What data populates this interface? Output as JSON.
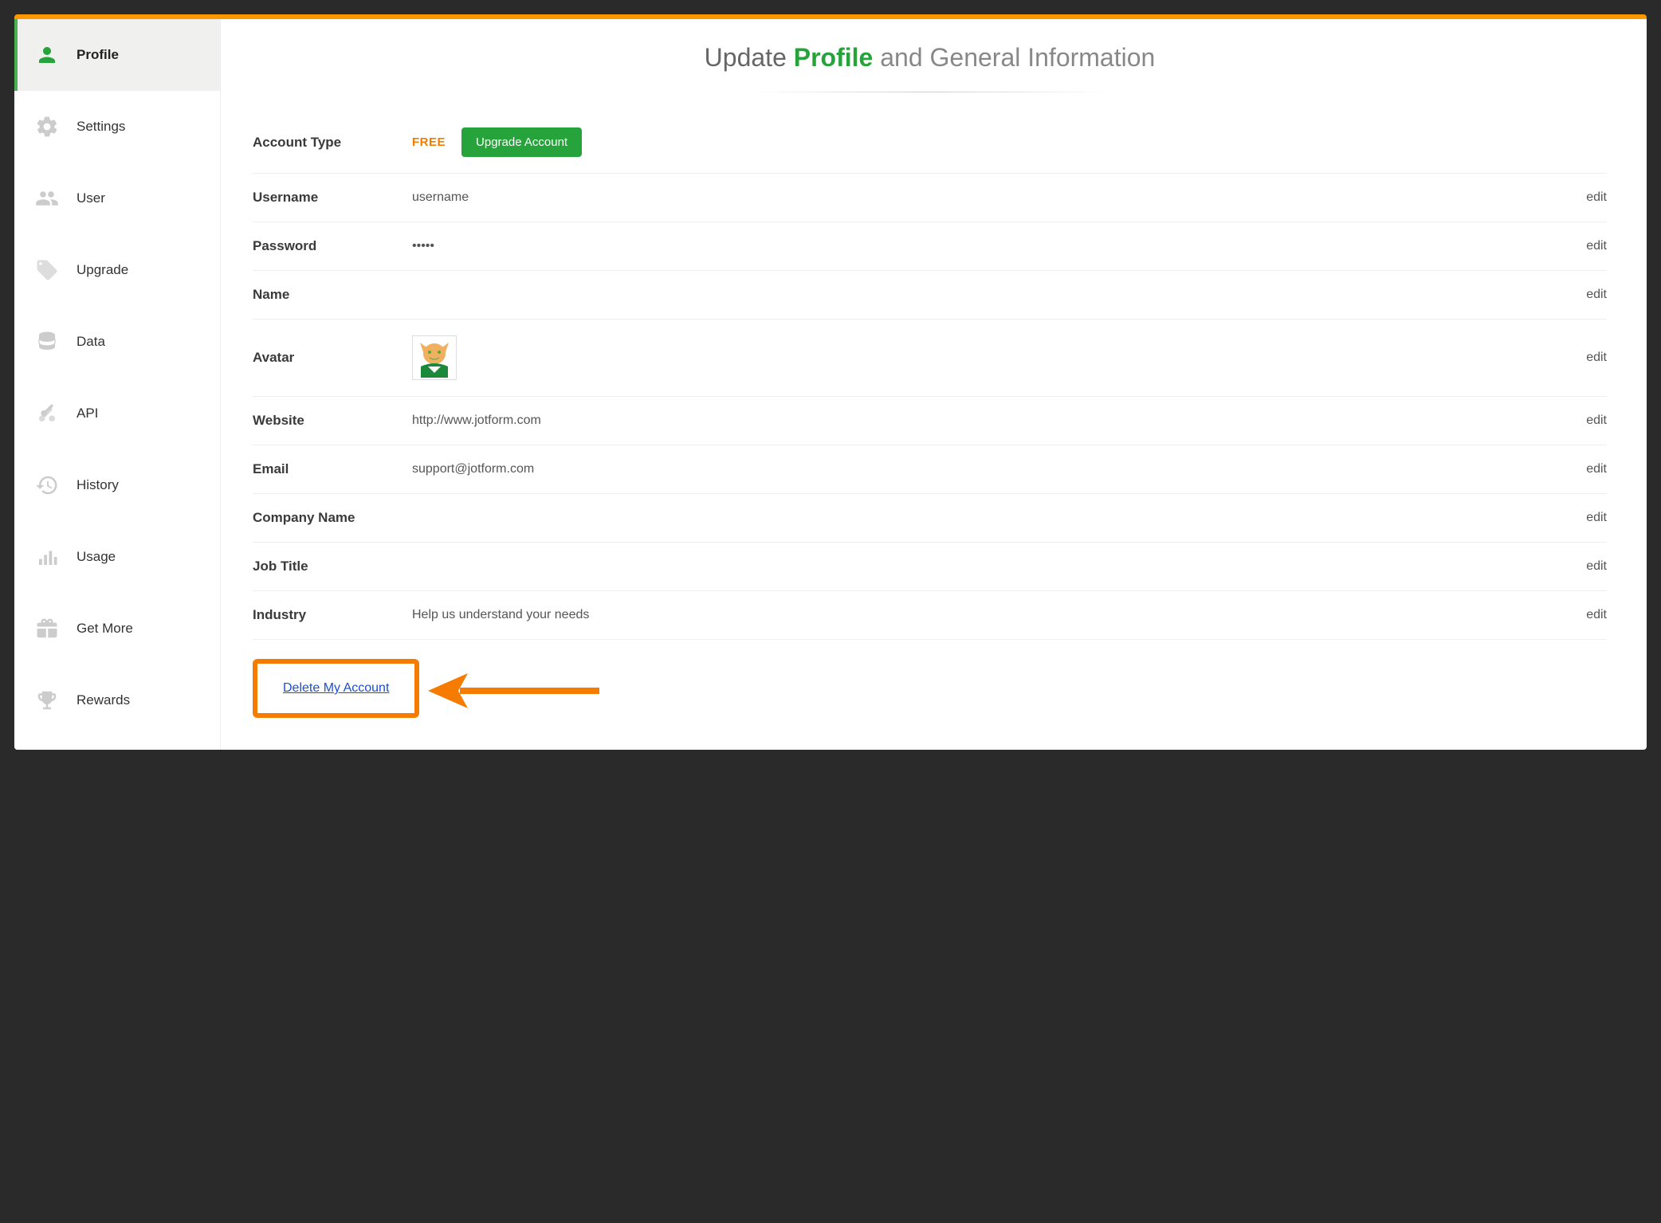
{
  "sidebar": {
    "items": [
      {
        "label": "Profile",
        "icon": "person"
      },
      {
        "label": "Settings",
        "icon": "gears"
      },
      {
        "label": "User",
        "icon": "users"
      },
      {
        "label": "Upgrade",
        "icon": "tag"
      },
      {
        "label": "Data",
        "icon": "database"
      },
      {
        "label": "API",
        "icon": "keys"
      },
      {
        "label": "History",
        "icon": "history"
      },
      {
        "label": "Usage",
        "icon": "bars"
      },
      {
        "label": "Get More",
        "icon": "gift"
      },
      {
        "label": "Rewards",
        "icon": "trophy"
      }
    ]
  },
  "header": {
    "prefix": "Update",
    "highlight": "Profile",
    "suffix": "and General Information"
  },
  "rows": {
    "account_type": {
      "label": "Account Type",
      "badge": "FREE",
      "button": "Upgrade Account"
    },
    "username": {
      "label": "Username",
      "value": "username",
      "edit": "edit"
    },
    "password": {
      "label": "Password",
      "value": "•••••",
      "edit": "edit"
    },
    "name": {
      "label": "Name",
      "value": "",
      "edit": "edit"
    },
    "avatar": {
      "label": "Avatar",
      "edit": "edit"
    },
    "website": {
      "label": "Website",
      "value": "http://www.jotform.com",
      "edit": "edit"
    },
    "email": {
      "label": "Email",
      "value": "support@jotform.com",
      "edit": "edit"
    },
    "company": {
      "label": "Company Name",
      "value": "",
      "edit": "edit"
    },
    "job_title": {
      "label": "Job Title",
      "value": "",
      "edit": "edit"
    },
    "industry": {
      "label": "Industry",
      "value": "Help us understand your needs",
      "edit": "edit"
    }
  },
  "delete": {
    "label": "Delete My Account"
  }
}
